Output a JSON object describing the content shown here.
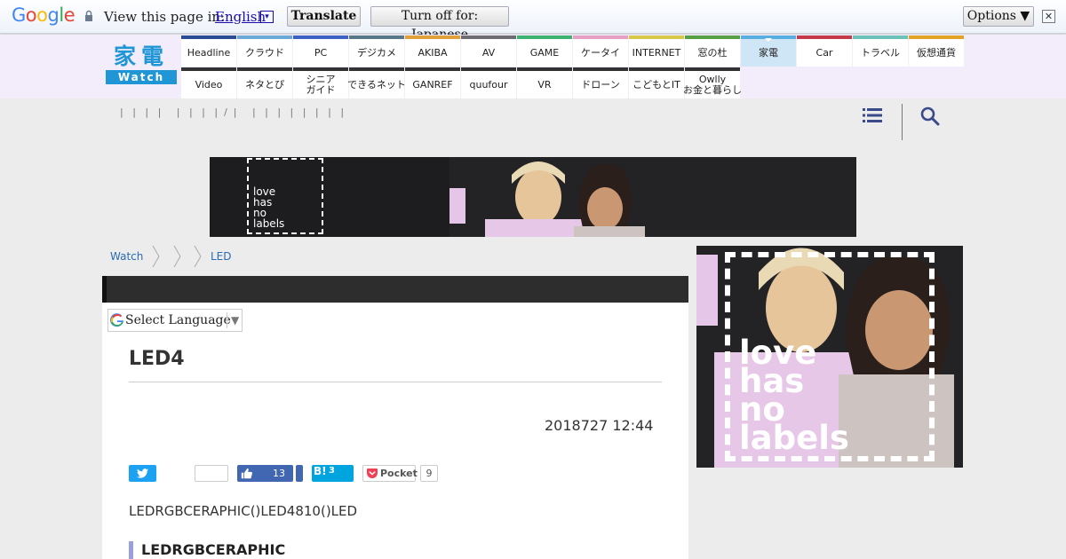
{
  "translate_bar": {
    "logo": "Google",
    "prompt": "View this page in:",
    "language": "English",
    "dropdown": "▾",
    "translate_button": "Translate",
    "turn_off_button": "Turn off for: Japanese",
    "options_button": "Options ▼",
    "close": "✕"
  },
  "site": {
    "logo_kanji": "家電",
    "logo_watch": "Watch",
    "nav_top": [
      {
        "label": "Headline",
        "color": "#2a4c93"
      },
      {
        "label": "クラウド",
        "color": "#6aa9d8"
      },
      {
        "label": "PC",
        "color": "#3d62c4"
      },
      {
        "label": "デジカメ",
        "color": "#58788a"
      },
      {
        "label": "AKIBA",
        "color": "#e0a13a"
      },
      {
        "label": "AV",
        "color": "#6d6d73"
      },
      {
        "label": "GAME",
        "color": "#3cb371"
      },
      {
        "label": "ケータイ",
        "color": "#e6a0c4"
      },
      {
        "label": "INTERNET",
        "color": "#d8c84a"
      },
      {
        "label": "窓の杜",
        "color": "#58a046"
      },
      {
        "label": "家電",
        "color": "#56aee2"
      },
      {
        "label": "Car",
        "color": "#c53a4b"
      },
      {
        "label": "トラベル",
        "color": "#6bc2b8"
      },
      {
        "label": "仮想通貨",
        "color": "#e3a425"
      }
    ],
    "nav_bottom": [
      {
        "label": "Video"
      },
      {
        "label": "ネタとぴ"
      },
      {
        "label": "シニア\nガイド"
      },
      {
        "label": "できるネット"
      },
      {
        "label": "GANREF"
      },
      {
        "label": "quufour"
      },
      {
        "label": "VR"
      },
      {
        "label": "ドローン"
      },
      {
        "label": "こどもとIT"
      },
      {
        "label": "Owlly\nお金と暮らし"
      }
    ],
    "toolbar_marks": "|   |   |   |     |   |   |   |  /  |     |   |   |   |   |   |   |   |"
  },
  "ads": {
    "lhnl_text": "love\nhas\nno\nlabels"
  },
  "breadcrumb": [
    "Watch",
    "",
    "",
    "LED"
  ],
  "article": {
    "select_language": "Select Language",
    "select_arrow": "▼",
    "title": "LED4",
    "date": "2018727 12:44",
    "share": {
      "facebook_count": "13",
      "hatena_label": "B!",
      "hatena_count": "3",
      "pocket_label": "Pocket",
      "pocket_count": "9"
    },
    "intro": "LEDRGBCERAPHIC()LED4810()LED",
    "subhead": "LEDRGBCERAPHIC"
  }
}
